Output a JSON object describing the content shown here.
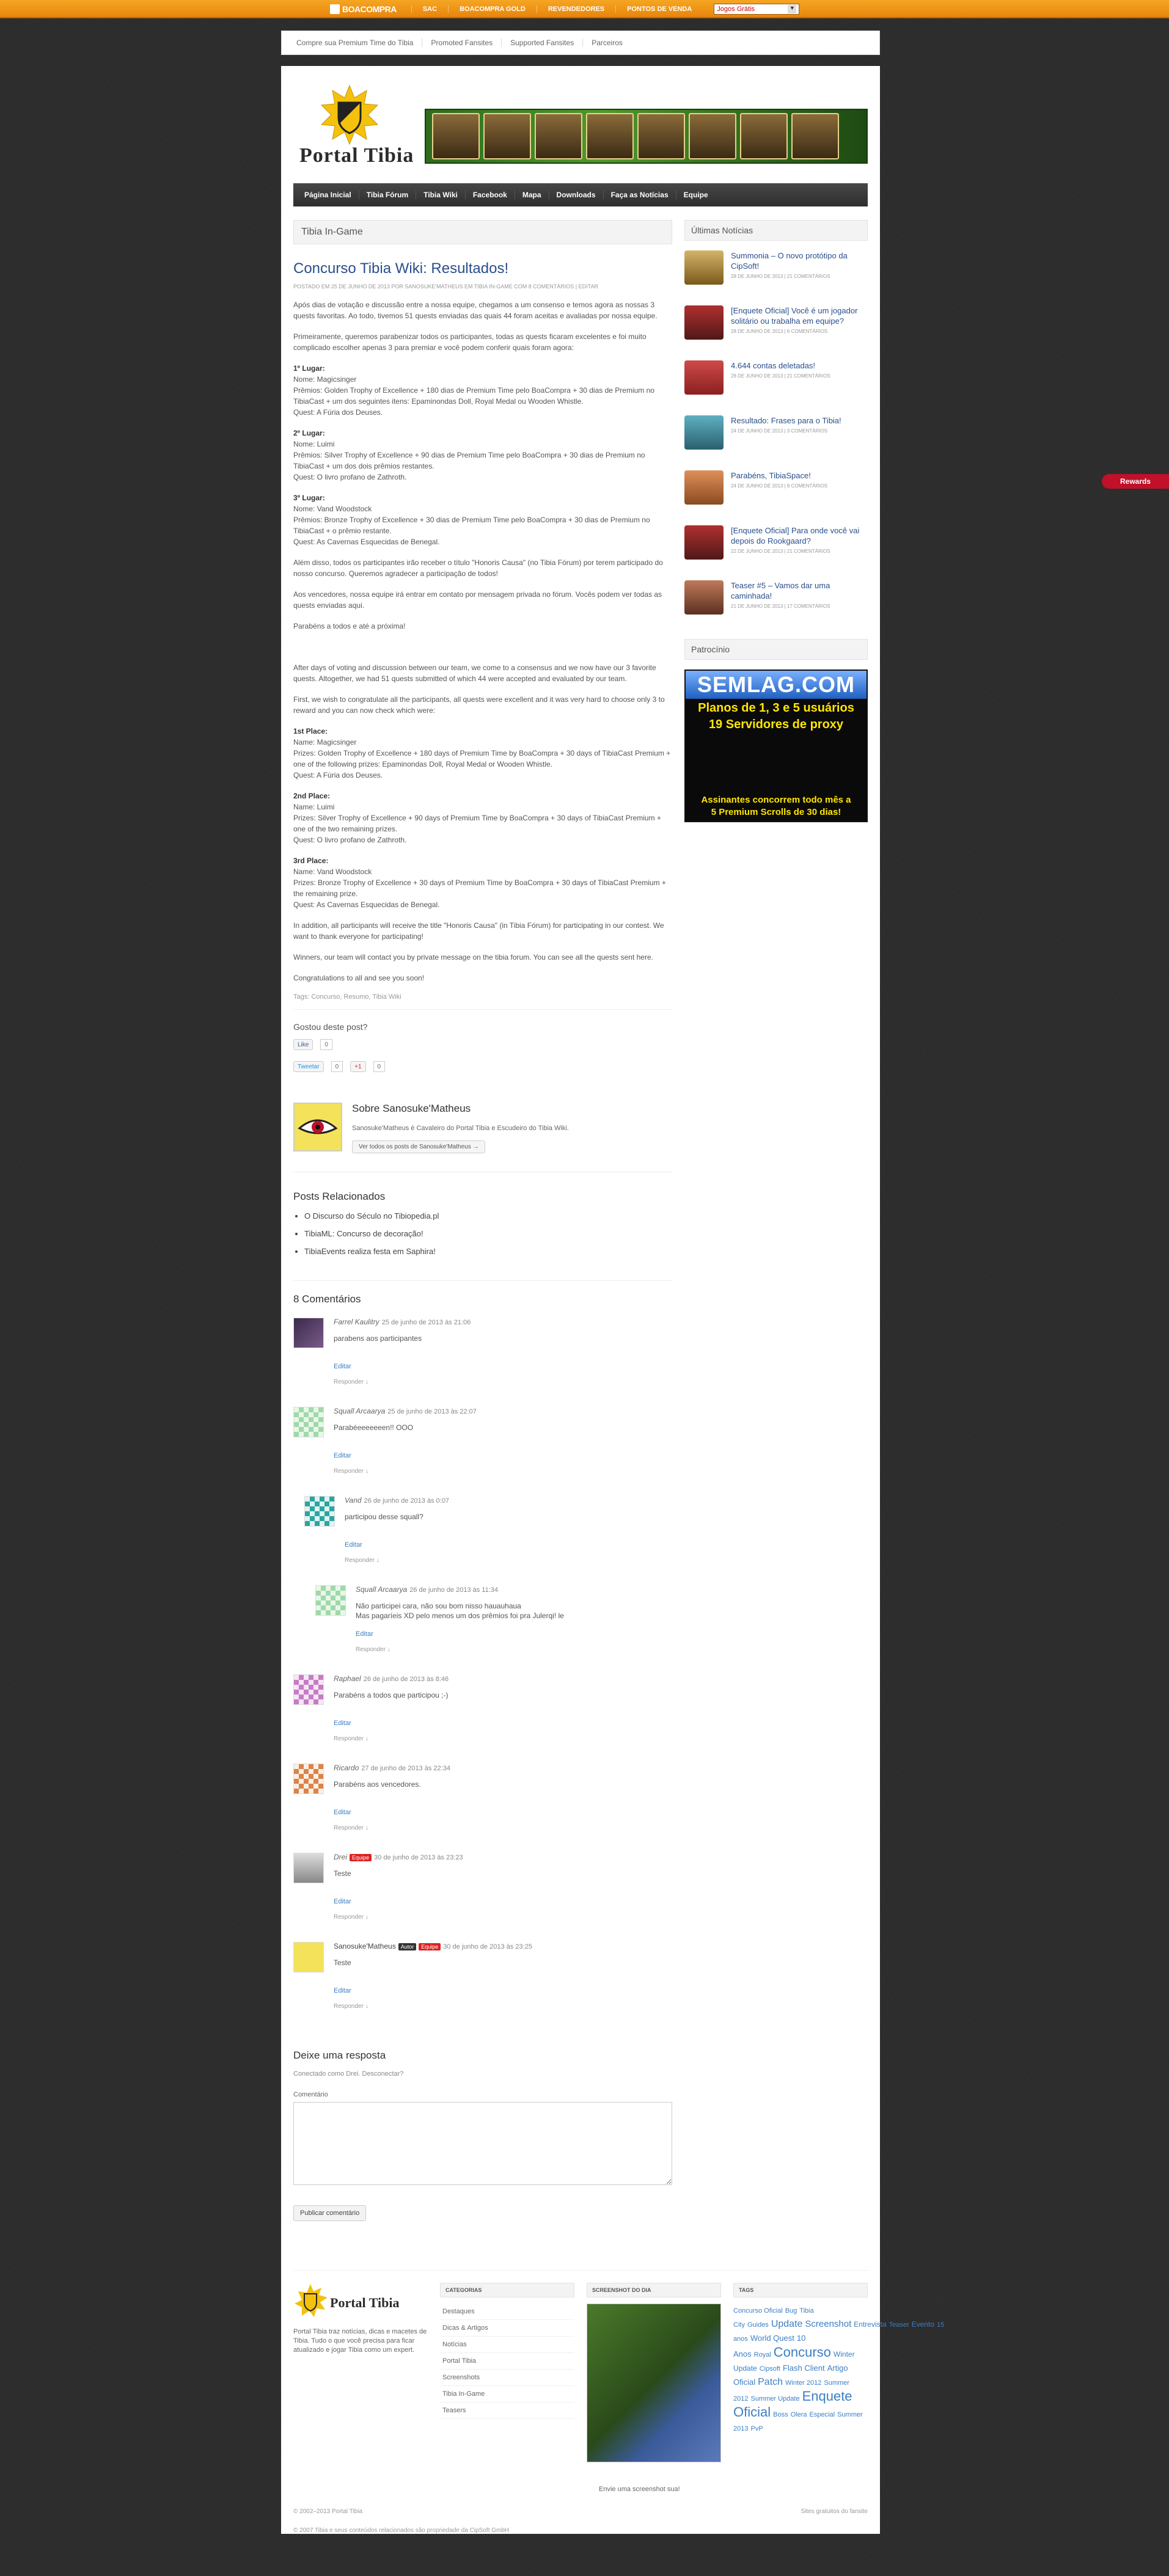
{
  "topbar": {
    "logo": "BOACOMPRA",
    "links": [
      "SAC",
      "BOACOMPRA GOLD",
      "REVENDEDORES",
      "PONTOS DE VENDA"
    ],
    "select_value": "Jogos Grátis"
  },
  "subnav": [
    "Compre sua Premium Time do Tibia",
    "Promoted Fansites",
    "Supported Fansites",
    "Parceiros"
  ],
  "logo_text": "Portal Tibia",
  "mainnav": [
    "Página Inicial",
    "Tibia Fórum",
    "Tibia Wiki",
    "Facebook",
    "Mapa",
    "Downloads",
    "Faça as Notícias",
    "Equipe"
  ],
  "category_title": "Tibia In-Game",
  "post": {
    "title": "Concurso Tibia Wiki: Resultados!",
    "meta": "POSTADO EM 25 DE JUNHO DE 2013 POR SANOSUKE'MATHEUS EM TIBIA IN-GAME COM 8 COMENTÁRIOS | EDITAR",
    "pt_intro": "Após dias de votação e discussão entre a nossa equipe, chegamos a um consenso e temos agora as nossas 3 quests favoritas. Ao todo, tivemos 51 quests enviadas das quais 44 foram aceitas e avaliadas por nossa equipe.",
    "pt_intro2": "Primeiramente, queremos parabenizar todos os participantes, todas as quests ficaram excelentes e foi muito complicado escolher apenas 3 para premiar e você podem conferir quais foram agora:",
    "pt_first": "1º Lugar:",
    "pt_first_name": "Nome: Magicsinger",
    "pt_first_prize": "Prêmios: Golden Trophy of Excellence + 180 dias de Premium Time pelo BoaCompra + 30 dias de Premium no TibiaCast + um dos seguintes itens: Epaminondas Doll, Royal Medal ou Wooden Whistle.",
    "pt_first_quest": "Quest: A Fúria dos Deuses.",
    "pt_second": "2º Lugar:",
    "pt_second_name": "Nome: Luimi",
    "pt_second_prize": "Prêmios: Silver Trophy of Excellence + 90 dias de Premium Time pelo BoaCompra + 30 dias de Premium no TibiaCast + um dos dois prêmios restantes.",
    "pt_second_quest": "Quest: O livro profano de Zathroth.",
    "pt_third": "3º Lugar:",
    "pt_third_name": "Nome: Vand Woodstock",
    "pt_third_prize": "Prêmios: Bronze Trophy of Excellence + 30 dias de Premium Time pelo BoaCompra + 30 dias de Premium no TibiaCast + o prêmio restante.",
    "pt_third_quest": "Quest: As Cavernas Esquecidas de Benegal.",
    "pt_honor": "Além disso, todos os participantes irão receber o título \"Honoris Causa\" (no Tibia Fórum) por terem participado do nosso concurso. Queremos agradecer a participação de todos!",
    "pt_contact": "Aos vencedores, nossa equipe irá entrar em contato por mensagem privada no fórum. Vocês podem ver todas as quests enviadas aqui.",
    "pt_bye": "Parabéns a todos e até a próxima!",
    "en_intro": "After days of voting and discussion between our team, we come to a consensus and we now have our 3 favorite quests. Altogether, we had 51 quests submitted of which 44 were accepted and evaluated by our team.",
    "en_intro2": "First, we wish to congratulate all the participants, all quests were excellent and it was very hard to choose only 3 to reward and you can now check which were:",
    "en_first": "1st Place:",
    "en_first_name": "Name: Magicsinger",
    "en_first_prize": "Prizes: Golden Trophy of Excellence + 180 days of Premium Time by BoaCompra + 30 days of TibiaCast Premium + one of the following prizes: Epaminondas Doll, Royal Medal or Wooden Whistle.",
    "en_first_quest": "Quest: A Fúria dos Deuses.",
    "en_second": "2nd Place:",
    "en_second_name": "Name: Luimi",
    "en_second_prize": "Prizes: Silver Trophy of Excellence + 90 days of Premium Time by BoaCompra + 30 days of TibiaCast Premium + one of the two remaining prizes.",
    "en_second_quest": "Quest: O livro profano de Zathroth.",
    "en_third": "3rd Place:",
    "en_third_name": "Name: Vand Woodstock",
    "en_third_prize": "Prizes: Bronze Trophy of Excellence + 30 days of Premium Time by BoaCompra + 30 days of TibiaCast Premium + the remaining prize.",
    "en_third_quest": "Quest: As Cavernas Esquecidas de Benegal.",
    "en_honor": "In addition, all participants will receive the title \"Honoris Causa\" (in Tibia Fórum) for participating in our contest. We want to thank everyone for participating!",
    "en_contact": "Winners, our team will contact you by private message on the tibia forum. You can see all the quests sent here.",
    "en_bye": "Congratulations to all and see you soon!",
    "tags": "Tags: Concurso, Resumo, Tibia Wiki"
  },
  "share": {
    "title": "Gostou deste post?",
    "like": "Like",
    "like_count": "0",
    "tweet": "Tweetar",
    "tweet_count": "0",
    "plus": "+1",
    "plus_count": "0"
  },
  "author": {
    "title": "Sobre Sanosuke'Matheus",
    "bio": "Sanosuke'Matheus é Cavaleiro do Portal Tibia e Escudeiro do Tibia Wiki.",
    "button": "Ver todos os posts de Sanosuke'Matheus →"
  },
  "related": {
    "title": "Posts Relacionados",
    "items": [
      "O Discurso do Século no Tibiopedia.pl",
      "TibiaML: Concurso de decoração!",
      "TibiaEvents realiza festa em Saphira!"
    ]
  },
  "comments_title": "8 Comentários",
  "comments": [
    {
      "name": "Farrel Kaulitry",
      "date": "25 de junho de 2013 às 21:06",
      "text": "parabens aos participantes",
      "edit": "Editar",
      "reply": "Responder ↓",
      "badge1": "",
      "badge2": ""
    },
    {
      "name": "Squall Arcaarya",
      "date": "25 de junho de 2013 às 22:07",
      "text": "Parabéeeeeeeen!! OOO",
      "edit": "Editar",
      "reply": "Responder ↓",
      "badge1": "",
      "badge2": ""
    },
    {
      "name": "Vand",
      "date": "26 de junho de 2013 às 0:07",
      "text": "participou desse squall?",
      "edit": "Editar",
      "reply": "Responder ↓",
      "badge1": "",
      "badge2": ""
    },
    {
      "name": "Squall Arcaarya",
      "date": "26 de junho de 2013 às 11:34",
      "text": "Não participei cara, não sou bom nisso hauauhaua",
      "text2": "Mas pagaríeis XD pelo menos um dos prêmios foi pra Julerqi! le",
      "edit": "Editar",
      "reply": "Responder ↓",
      "badge1": "",
      "badge2": ""
    },
    {
      "name": "Raphael",
      "date": "26 de junho de 2013 às 8:46",
      "text": "Parabéns a todos que participou ;-)",
      "edit": "Editar",
      "reply": "Responder ↓",
      "badge1": "",
      "badge2": ""
    },
    {
      "name": "Ricardo",
      "date": "27 de junho de 2013 às 22:34",
      "text": "Parabéns aos vencedores.",
      "edit": "Editar",
      "reply": "Responder ↓",
      "badge1": "",
      "badge2": ""
    },
    {
      "name": "Drei",
      "date": "30 de junho de 2013 às 23:23",
      "text": "Teste",
      "edit": "Editar",
      "reply": "Responder ↓",
      "badge1": "Equipe",
      "badge2": ""
    },
    {
      "name": "Sanosuke'Matheus",
      "date": "30 de junho de 2013 às 23:25",
      "text": "Teste",
      "edit": "Editar",
      "reply": "Responder ↓",
      "badge1": "Autor",
      "badge2": "Equipe"
    }
  ],
  "respond": {
    "title": "Deixe uma resposta",
    "logged": "Conectado como Drei. Desconectar?",
    "label": "Comentário",
    "submit": "Publicar comentário"
  },
  "sidebar": {
    "news_title": "Últimas Notícias",
    "news": [
      {
        "title": "Summonia – O novo protótipo da CipSoft!",
        "date": "28 DE JUNHO DE 2013 | 21 COMENTÁRIOS"
      },
      {
        "title": "[Enquete Oficial] Você é um jogador solitário ou trabalha em equipe?",
        "date": "28 DE JUNHO DE 2013 | 6 COMENTÁRIOS"
      },
      {
        "title": "4.644 contas deletadas!",
        "date": "28 DE JUNHO DE 2013 | 21 COMENTÁRIOS"
      },
      {
        "title": "Resultado: Frases para o Tibia!",
        "date": "24 DE JUNHO DE 2013 | 3 COMENTÁRIOS"
      },
      {
        "title": "Parabéns, TibiaSpace!",
        "date": "24 DE JUNHO DE 2013 | 8 COMENTÁRIOS"
      },
      {
        "title": "[Enquete Oficial] Para onde você vai depois do Rookgaard?",
        "date": "22 DE JUNHO DE 2013 | 21 COMENTÁRIOS"
      },
      {
        "title": "Teaser #5 – Vamos dar uma caminhada!",
        "date": "21 DE JUNHO DE 2013 | 17 COMENTÁRIOS"
      }
    ],
    "sponsor_title": "Patrocínio",
    "ad_head": "SEMLAG.COM",
    "ad_line1": "Planos de 1, 3 e 5 usuários",
    "ad_line2": "19 Servidores de proxy",
    "ad_foot1": "Assinantes concorrem todo mês a",
    "ad_foot2": "5 Premium Scrolls de 30 dias!"
  },
  "footer": {
    "about": "Portal Tibia traz notícias, dicas e macetes de Tibia. Tudo o que você precisa para ficar atualizado e jogar Tibia como um expert.",
    "categories_title": "CATEGORIAS",
    "categories": [
      "Destaques",
      "Dicas & Artigos",
      "Notícias",
      "Portal Tibia",
      "Screenshots",
      "Tibia In-Game",
      "Teasers"
    ],
    "screenshot_title": "SCREENSHOT DO DIA",
    "tags_title": "TAGS",
    "tags": [
      "Concurso Oficial",
      "Bug",
      "Tibia City",
      "Guides",
      "Update",
      "Screenshot",
      "Entrevista",
      "Teaser",
      "Evento",
      "15 anos",
      "World Quest",
      "10 Anos",
      "Royal",
      "Concurso",
      "Winter Update",
      "Cipsoft",
      "Flash Client",
      "Artigo Oficial",
      "Patch",
      "Winter 2012",
      "Summer 2012",
      "Summer Update",
      "Enquete Oficial",
      "Boss",
      "Olera",
      "Especial",
      "Summer 2013",
      "PvP"
    ],
    "shot_link": "Envie uma screenshot sua!",
    "copyright": "© 2002–2013 Portal Tibia",
    "copyright2": "© 2007 Tibia e seus conteúdos relacionados são propriedade da CipSoft GmbH",
    "right": "Sites gratuitos do fansite"
  },
  "rewards": "Rewards"
}
